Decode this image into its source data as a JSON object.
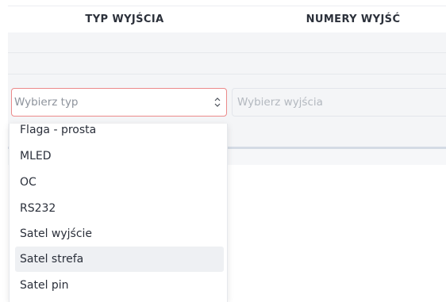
{
  "table": {
    "headers": {
      "output_type": "TYP WYJŚCIA",
      "output_numbers": "NUMERY WYJŚĆ"
    }
  },
  "type_select": {
    "placeholder": "Wybierz typ",
    "caret_icon": "chevron-updown-icon",
    "border_color": "#ec8a8a"
  },
  "outputs_select": {
    "placeholder": "Wybierz wyjścia"
  },
  "dropdown": {
    "options": [
      {
        "label": "Flaga - prosta"
      },
      {
        "label": "MLED"
      },
      {
        "label": "OC"
      },
      {
        "label": "RS232"
      },
      {
        "label": "Satel wyjście"
      },
      {
        "label": "Satel strefa"
      },
      {
        "label": "Satel pin"
      }
    ],
    "highlighted": "Satel strefa",
    "highlight_color": "#eef0f3"
  }
}
